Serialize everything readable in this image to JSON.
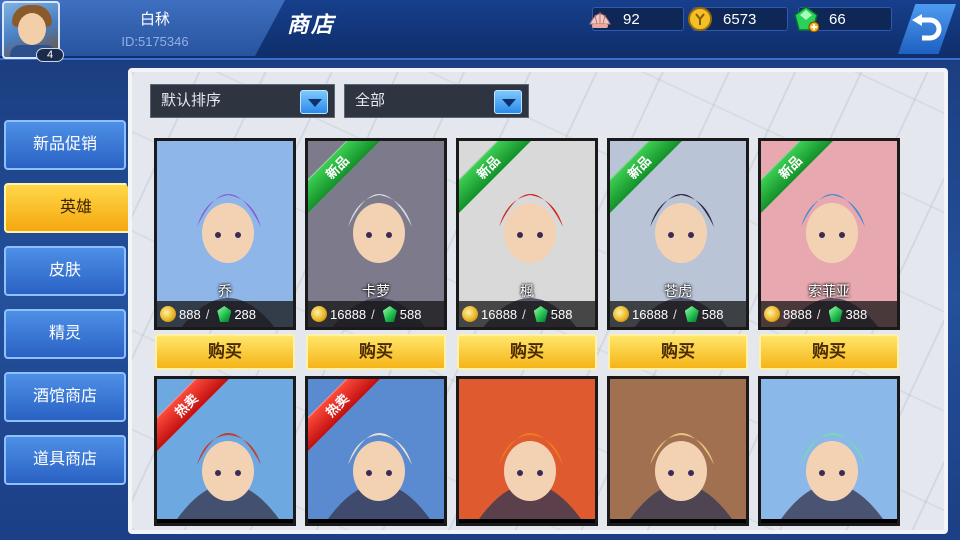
{
  "player": {
    "name": "白秫",
    "id": "ID:5175346",
    "level": "4"
  },
  "header": {
    "title": "商店"
  },
  "currencies": [
    {
      "icon": "shell-icon",
      "value": "92"
    },
    {
      "icon": "gold-coin-icon",
      "value": "6573"
    },
    {
      "icon": "green-gem-plus-icon",
      "value": "66"
    }
  ],
  "sidebar": {
    "items": [
      {
        "label": "新品促销",
        "active": false
      },
      {
        "label": "英雄",
        "active": true
      },
      {
        "label": "皮肤",
        "active": false
      },
      {
        "label": "精灵",
        "active": false
      },
      {
        "label": "酒馆商店",
        "active": false
      },
      {
        "label": "道具商店",
        "active": false
      }
    ]
  },
  "filters": {
    "sort": "默认排序",
    "category": "全部"
  },
  "buy_label": "购买",
  "heroes_row1": [
    {
      "name": "乔",
      "tag": "",
      "gold": "888",
      "gem": "288",
      "hair": "#8a5ad0",
      "bg": "#8fb6e8"
    },
    {
      "name": "卡萝",
      "tag": "新品",
      "gold": "16888",
      "gem": "588",
      "hair": "#d8dce6",
      "bg": "#7d7a8c"
    },
    {
      "name": "楓",
      "tag": "新品",
      "gold": "16888",
      "gem": "588",
      "hair": "#d4261c",
      "bg": "#d9d9d9"
    },
    {
      "name": "苍虎",
      "tag": "新品",
      "gold": "16888",
      "gem": "588",
      "hair": "#2b2440",
      "bg": "#b9c4d6"
    },
    {
      "name": "索菲亚",
      "tag": "新品",
      "gold": "8888",
      "gem": "388",
      "hair": "#3e8ad8",
      "bg": "#e8a8b0"
    }
  ],
  "heroes_row2": [
    {
      "tag": "热卖",
      "hair": "#c43a2a",
      "bg": "#6ea8e0"
    },
    {
      "tag": "热卖",
      "hair": "#e8e2d0",
      "bg": "#5a8ad0"
    },
    {
      "tag": "",
      "hair": "#f07a20",
      "bg": "#e05a30"
    },
    {
      "tag": "",
      "hair": "#e8c27a",
      "bg": "#a07050"
    },
    {
      "tag": "",
      "hair": "#7ad8b0",
      "bg": "#8ab8e8"
    }
  ]
}
